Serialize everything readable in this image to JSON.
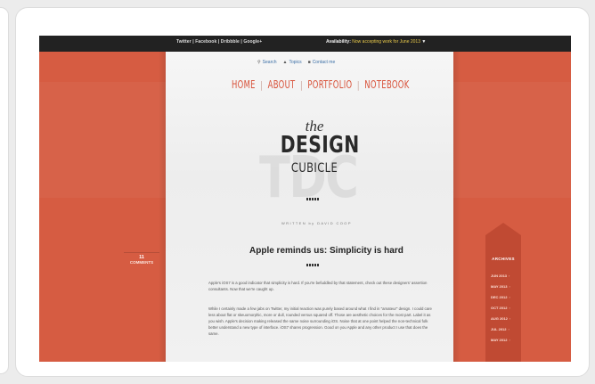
{
  "topbar": {
    "social_links": "Twitter | Facebook | Dribbble | Google+",
    "availability_label": "Availability:",
    "availability_text": "Now accepting work for June 2013",
    "availability_caret": "▼"
  },
  "utility_links": [
    {
      "icon": "search-icon",
      "label": "Search"
    },
    {
      "icon": "topics-icon",
      "label": "Topics"
    },
    {
      "icon": "mail-icon",
      "label": "Contact me"
    }
  ],
  "nav": [
    "HOME",
    "ABOUT",
    "PORTFOLIO",
    "NOTEBOOK"
  ],
  "logo": {
    "the": "the",
    "design": "DESIGN",
    "cubicle": "CUBICLE",
    "watermark": "TDC"
  },
  "post": {
    "byline": "WRITTEN by DAVID COOP",
    "title": "Apple reminds us: Simplicity is hard",
    "paragraph_1": "Apple's iOS7 is a good indicator that simplicity is hard. If you're befuddled by that statement, check out these designers' assertion consultants. Now that we're caught up.",
    "link_1": "designers' assertion consultants",
    "paragraph_2": "While I certainly made a few jabs on Twitter, my initial reaction was purely based around what I find in \"amateur\" design. I could care less about flat or skeuomorphic, more or dull, rounded versus squared off. Those are aesthetic choices for the most part. Label it as you wish. Apple's decision making released the same noise surrounding iOS. Noise that at one point helped the non-technical folk better understand a new type of interface. iOS7 shares progression. Good on you Apple and any other product I use that does the same.",
    "link_2": "few jabs"
  },
  "comments": {
    "count": "11",
    "label": "COMMENTS"
  },
  "archive": {
    "heading": "ARCHIVES",
    "items": [
      "JUN 2013",
      "MAY 2013",
      "DEC 2012",
      "OCT 2012",
      "AUG 2012",
      "JUL 2012",
      "MAY 2012"
    ]
  },
  "colors": {
    "accent": "#d65c42",
    "topbar": "#222222",
    "highlight": "#e8c94a",
    "link": "#3a6ea5"
  }
}
